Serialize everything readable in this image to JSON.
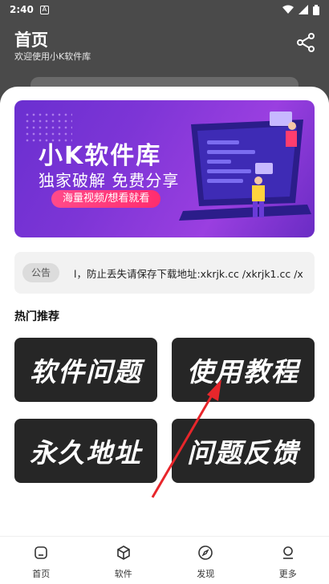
{
  "status_bar": {
    "time": "2:40",
    "notification_badge": "A"
  },
  "header": {
    "title": "首页",
    "subtitle": "欢迎使用小K软件库",
    "share_icon": "share-icon"
  },
  "banner": {
    "title": "小K软件库",
    "slogan": "独家破解 免费分享",
    "tag": "海量视频/想看就看"
  },
  "notice": {
    "label": "公告",
    "text": "l，防止丢失请保存下载地址:xkrjk.cc /xkrjk1.cc /x"
  },
  "section_title": "热门推荐",
  "tiles": [
    {
      "label": "软件问题"
    },
    {
      "label": "使用教程"
    },
    {
      "label": "永久地址"
    },
    {
      "label": "问题反馈"
    }
  ],
  "nav": [
    {
      "label": "首页",
      "icon": "home-icon"
    },
    {
      "label": "软件",
      "icon": "box-icon"
    },
    {
      "label": "发现",
      "icon": "compass-icon"
    },
    {
      "label": "更多",
      "icon": "person-icon"
    }
  ],
  "colors": {
    "header_bg": "#4a4a4a",
    "tile_bg": "#262626",
    "arrow": "#e8262b",
    "banner_purple": "#7d35d6"
  }
}
